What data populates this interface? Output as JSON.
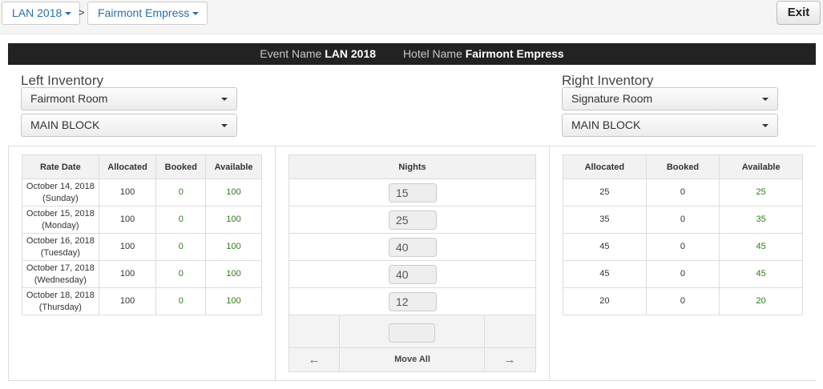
{
  "breadcrumb": {
    "event": "LAN 2018",
    "separator": ">",
    "hotel": "Fairmont Empress"
  },
  "exit_label": "Exit",
  "banner": {
    "event_label": "Event Name",
    "event_value": "LAN 2018",
    "hotel_label": "Hotel Name",
    "hotel_value": "Fairmont Empress"
  },
  "left": {
    "title": "Left Inventory",
    "room_select": "Fairmont Room",
    "block_select": "MAIN BLOCK",
    "columns": [
      "Rate Date",
      "Allocated",
      "Booked",
      "Available"
    ],
    "rows": [
      {
        "date": "October 14, 2018",
        "day": "(Sunday)",
        "allocated": "100",
        "booked": "0",
        "available": "100"
      },
      {
        "date": "October 15, 2018",
        "day": "(Monday)",
        "allocated": "100",
        "booked": "0",
        "available": "100"
      },
      {
        "date": "October 16, 2018",
        "day": "(Tuesday)",
        "allocated": "100",
        "booked": "0",
        "available": "100"
      },
      {
        "date": "October 17, 2018",
        "day": "(Wednesday)",
        "allocated": "100",
        "booked": "0",
        "available": "100"
      },
      {
        "date": "October 18, 2018",
        "day": "(Thursday)",
        "allocated": "100",
        "booked": "0",
        "available": "100"
      }
    ]
  },
  "middle": {
    "header": "Nights",
    "nights": [
      "15",
      "25",
      "40",
      "40",
      "12"
    ],
    "move_all_label": "Move All",
    "arrow_left": "←",
    "arrow_right": "→"
  },
  "right": {
    "title": "Right Inventory",
    "room_select": "Signature Room",
    "block_select": "MAIN BLOCK",
    "columns": [
      "Allocated",
      "Booked",
      "Available"
    ],
    "rows": [
      {
        "allocated": "25",
        "booked": "0",
        "available": "25"
      },
      {
        "allocated": "35",
        "booked": "0",
        "available": "35"
      },
      {
        "allocated": "45",
        "booked": "0",
        "available": "45"
      },
      {
        "allocated": "45",
        "booked": "0",
        "available": "45"
      },
      {
        "allocated": "20",
        "booked": "0",
        "available": "20"
      }
    ]
  },
  "colors": {
    "link": "#2a6fae",
    "banner_bg": "#222222",
    "available_green": "#2e7d1a"
  }
}
